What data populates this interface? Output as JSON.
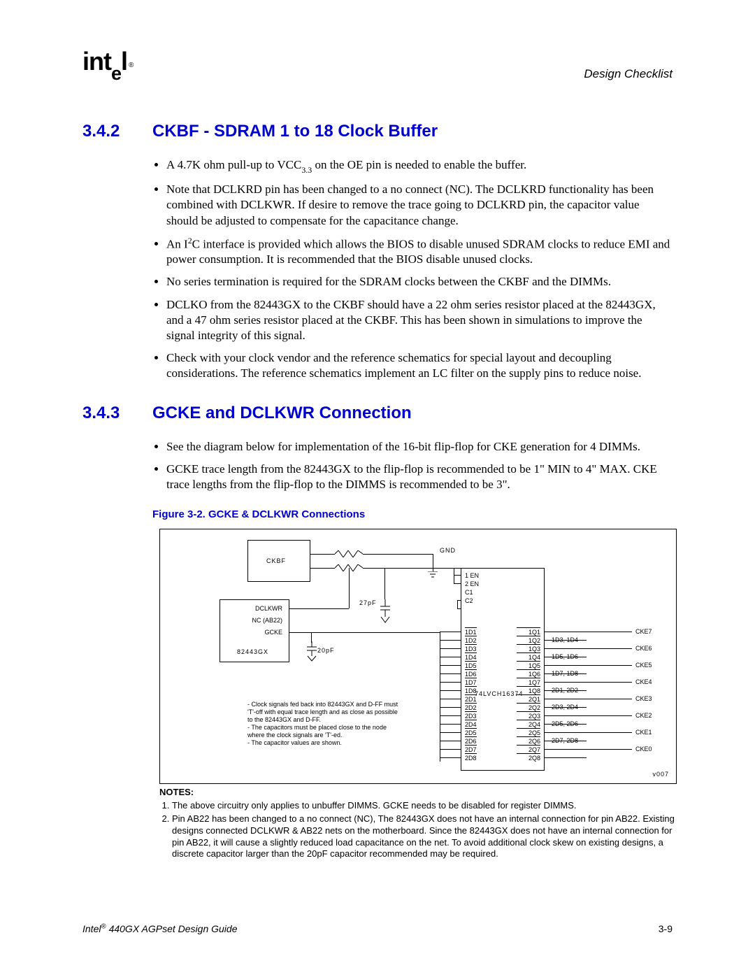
{
  "header": {
    "logo_main": "intel",
    "doc_section": "Design Checklist"
  },
  "sections": [
    {
      "num": "3.4.2",
      "title": "CKBF - SDRAM 1 to 18 Clock Buffer",
      "bullets": [
        "A 4.7K ohm pull-up to VCC₃.₃ on the OE pin is needed to enable the buffer.",
        "Note that DCLKRD pin has been changed to a no connect (NC). The DCLKRD functionality has been combined with DCLKWR. If desire to remove the trace going to DCLKRD pin, the capacitor value should be adjusted to compensate for the capacitance change.",
        "An I²C interface is provided which allows the BIOS to disable unused SDRAM clocks  to reduce EMI and power consumption. It is recommended that the BIOS disable unused clocks.",
        "No series termination is required for the SDRAM clocks between the CKBF and the DIMMs.",
        "DCLKO from the 82443GX to the CKBF should have a 22 ohm series resistor placed at the 82443GX, and a 47 ohm series resistor placed at the CKBF. This has been shown in simulations to improve the signal integrity of this signal.",
        "Check with your clock vendor and the reference schematics for special layout and decoupling considerations. The reference schematics implement an LC filter on the supply pins to reduce noise."
      ]
    },
    {
      "num": "3.4.3",
      "title": "GCKE and DCLKWR Connection",
      "bullets": [
        "See the diagram below for implementation of the 16-bit flip-flop for CKE generation for 4 DIMMs.",
        "GCKE trace length from the 82443GX to the flip-flop is recommended to be 1\" MIN to 4\" MAX. CKE trace lengths from the flip-flop to the DIMMS is recommended to be 3\"."
      ]
    }
  ],
  "figure": {
    "caption": "Figure 3-2. GCKE & DCLKWR Connections",
    "labels": {
      "ckbf": "CKBF",
      "dclkwr": "DCLKWR",
      "nc": "NC (AB22)",
      "gcke": "GCKE",
      "chip": "82443GX",
      "gnd": "GND",
      "cap27": "27pF",
      "cap20": "20pF",
      "ff": "74LVCH16374",
      "en_pins": [
        "1 EN",
        "2 EN",
        "C1",
        "C2"
      ],
      "d_pins": [
        "1D1",
        "1D2",
        "1D3",
        "1D4",
        "1D5",
        "1D6",
        "1D7",
        "1D8",
        "2D1",
        "2D2",
        "2D3",
        "2D4",
        "2D5",
        "2D6",
        "2D7",
        "2D8"
      ],
      "q_pins": [
        "1Q1",
        "1Q2",
        "1Q3",
        "1Q4",
        "1Q5",
        "1Q6",
        "1Q7",
        "1Q8",
        "2Q1",
        "2Q2",
        "2Q3",
        "2Q4",
        "2Q5",
        "2Q6",
        "2Q7",
        "2Q8"
      ],
      "q_notes": [
        "",
        "1D3, 1D4",
        "",
        "1D5, 1D6",
        "",
        "1D7, 1D8",
        "",
        "2D1, 2D2",
        "",
        "2D3, 2D4",
        "",
        "2D5, 2D6",
        "",
        "2D7, 2D8",
        "",
        ""
      ],
      "cke_out": [
        "CKE7",
        "",
        "CKE6",
        "",
        "CKE5",
        "",
        "CKE4",
        "",
        "CKE3",
        "",
        "CKE2",
        "",
        "CKE1",
        "",
        "CKE0",
        ""
      ],
      "rev": "v007"
    },
    "diag_notes": [
      "- Clock signals fed back into 82443GX and D-FF must  'T'-off with equal trace length and  as close as possible to the 82443GX and D-FF.",
      "- The capacitors must be placed close to  the node where the clock signals are 'T'-ed.",
      "- The capacitor values are shown."
    ]
  },
  "notes": {
    "title": "NOTES:",
    "items": [
      "The above circuitry only applies to unbuffer DIMMS. GCKE needs to be disabled for register DIMMS.",
      "Pin AB22 has been changed to a no connect (NC), The 82443GX does not have an internal connection for pin AB22. Existing designs connected DCLKWR & AB22 nets on the motherboard. Since the 82443GX does not have an internal connection for pin AB22, it will cause a slightly reduced load capacitance on the net. To avoid additional clock skew on existing designs, a discrete capacitor larger than the 20pF capacitor recommended may be required."
    ]
  },
  "footer": {
    "left": "Intel® 440GX AGPset Design Guide",
    "right": "3-9"
  }
}
